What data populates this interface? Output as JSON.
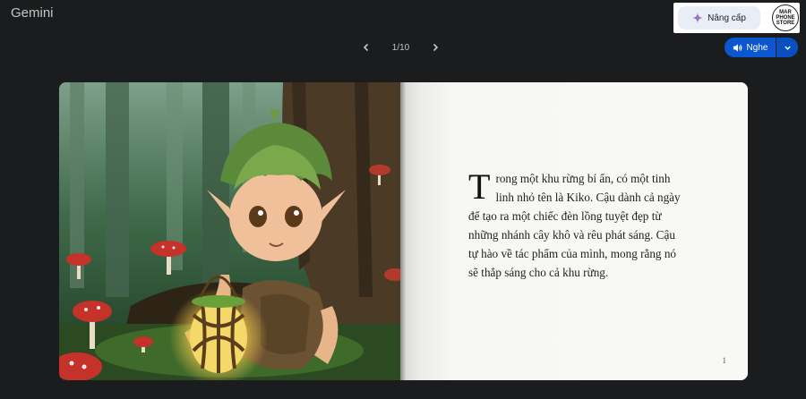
{
  "app": {
    "title": "Gemini"
  },
  "header": {
    "upgrade_label": "Nâng cấp",
    "avatar_text": [
      "MAR",
      "PHONE",
      "STORE"
    ]
  },
  "pager": {
    "current": "1/10"
  },
  "listen": {
    "label": "Nghe"
  },
  "book": {
    "dropcap": "T",
    "text": "rong một khu rừng bí ẩn, có một tinh linh nhỏ tên là Kiko. Cậu dành cả ngày để tạo ra một chiếc đèn lồng tuyệt đẹp từ những nhánh cây khô và rêu phát sáng. Cậu tự hào về tác phẩm của mình, mong rằng nó sẽ thắp sáng cho cả khu rừng.",
    "page_number": "1"
  },
  "colors": {
    "accent": "#0b57d0",
    "background": "#1b1c1d"
  },
  "icons": [
    "sparkle-icon",
    "chevron-left-icon",
    "chevron-right-icon",
    "speaker-icon",
    "chevron-down-icon"
  ]
}
